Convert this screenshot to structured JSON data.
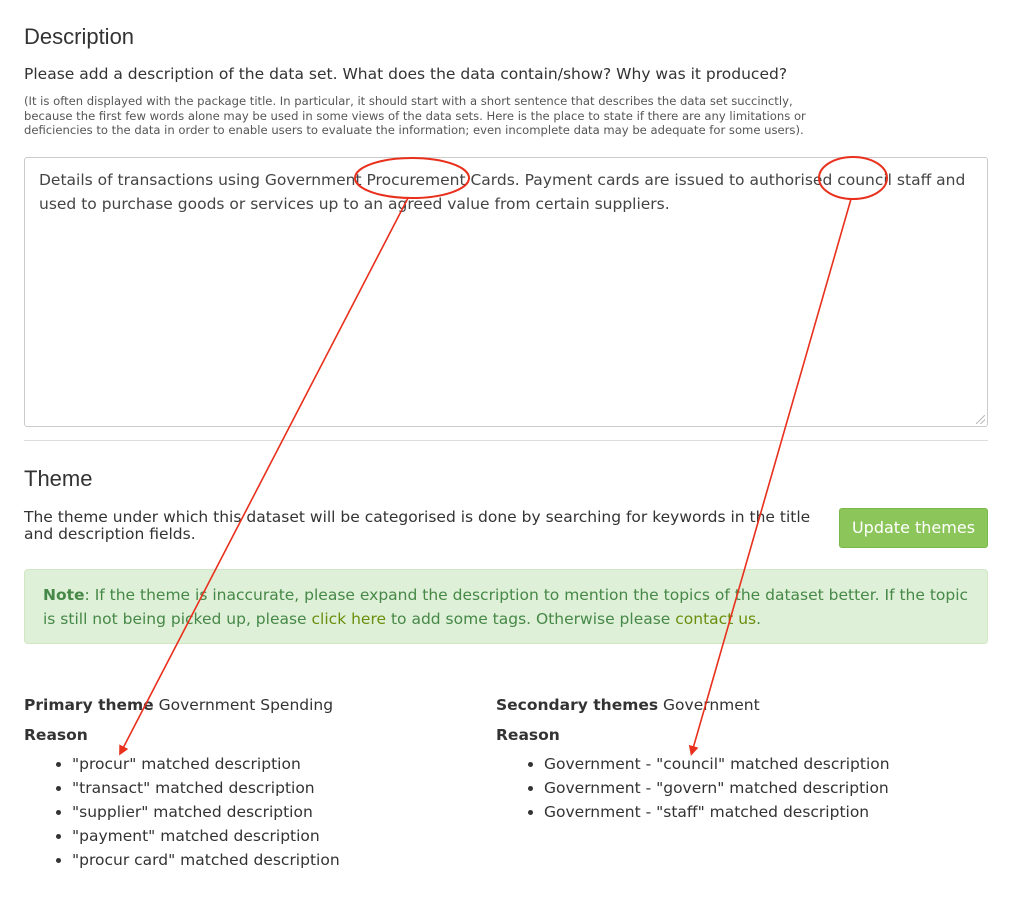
{
  "description_section": {
    "title": "Description",
    "question": "Please add a description of the data set. What does the data contain/show? Why was it produced?",
    "help": "(It is often displayed with the package title. In particular, it should start with a short sentence that describes the data set succinctly, because the first few words alone may be used in some views of the data sets. Here is the place to state if there are any limitations or deficiencies to the data in order to enable users to evaluate the information; even incomplete data may be adequate for some users).",
    "value": "Details of transactions using Government Procurement Cards. Payment cards are issued to authorised council staff and used to purchase goods or services up to an agreed value from certain suppliers."
  },
  "theme_section": {
    "title": "Theme",
    "description": "The theme under which this dataset will be categorised is done by searching for keywords in the title and description fields.",
    "update_button": "Update themes"
  },
  "note": {
    "label": "Note",
    "text1": ": If the theme is inaccurate, please expand the description to mention the topics of the dataset better. If the topic is still not being picked up, please ",
    "link1": "click here",
    "text2": " to add some tags. Otherwise please ",
    "link2": "contact us",
    "text3": "."
  },
  "primary": {
    "label": "Primary theme",
    "value": "Government Spending",
    "reason_label": "Reason",
    "reasons": [
      "\"procur\" matched description",
      "\"transact\" matched description",
      "\"supplier\" matched description",
      "\"payment\" matched description",
      "\"procur card\" matched description"
    ]
  },
  "secondary": {
    "label": "Secondary themes",
    "value": "Government",
    "reason_label": "Reason",
    "reasons": [
      "Government - \"council\" matched description",
      "Government - \"govern\" matched description",
      "Government - \"staff\" matched description"
    ]
  },
  "colors": {
    "annotation": "#e8301c",
    "button": "#8cc65a",
    "note_bg": "#dff0d8",
    "note_text": "#468847"
  }
}
